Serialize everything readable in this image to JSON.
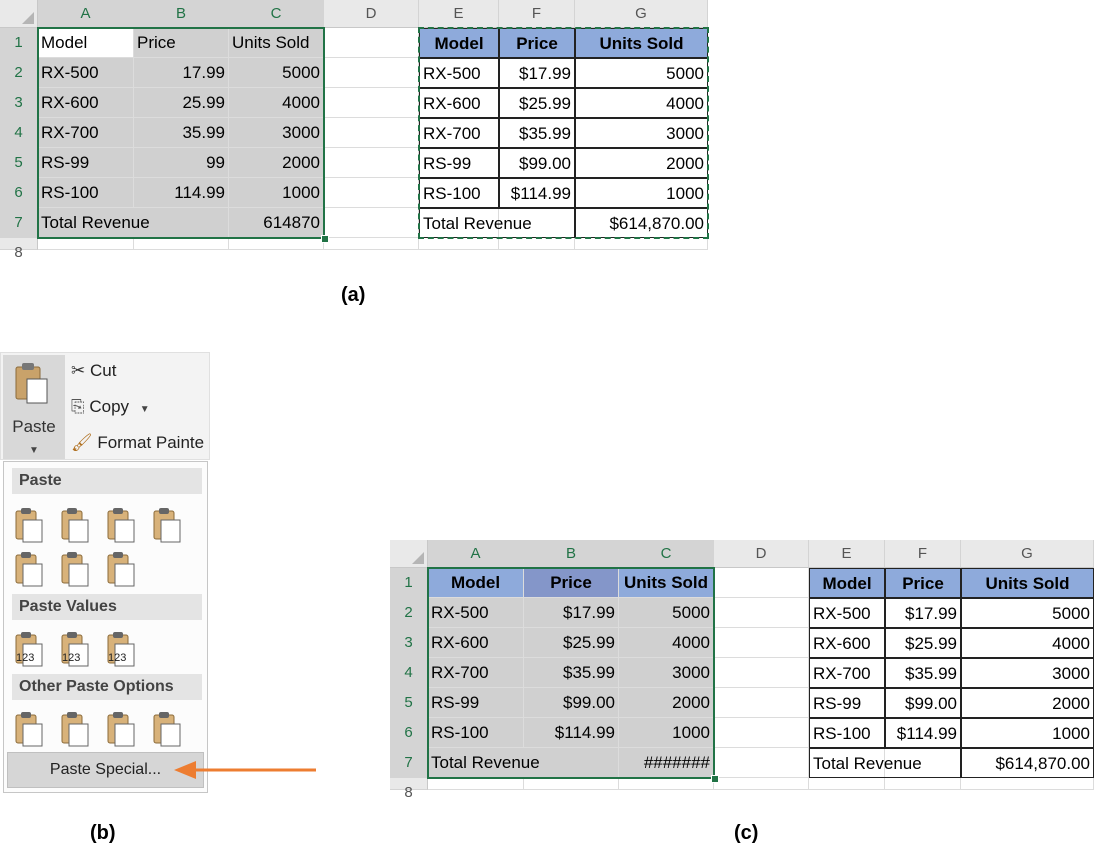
{
  "columns": [
    "A",
    "B",
    "C",
    "D",
    "E",
    "F",
    "G"
  ],
  "rows": [
    "1",
    "2",
    "3",
    "4",
    "5",
    "6",
    "7",
    "8"
  ],
  "left_table": {
    "header": [
      "Model",
      "Price",
      "Units Sold"
    ],
    "data": [
      [
        "RX-500",
        "17.99",
        "5000"
      ],
      [
        "RX-600",
        "25.99",
        "4000"
      ],
      [
        "RX-700",
        "35.99",
        "3000"
      ],
      [
        "RS-99",
        "99",
        "2000"
      ],
      [
        "RS-100",
        "114.99",
        "1000"
      ]
    ],
    "total_label": "Total Revenue",
    "total_value": "614870"
  },
  "right_table": {
    "header": [
      "Model",
      "Price",
      "Units Sold"
    ],
    "data": [
      [
        "RX-500",
        "$17.99",
        "5000"
      ],
      [
        "RX-600",
        "$25.99",
        "4000"
      ],
      [
        "RX-700",
        "$35.99",
        "3000"
      ],
      [
        "RS-99",
        "$99.00",
        "2000"
      ],
      [
        "RS-100",
        "$114.99",
        "1000"
      ]
    ],
    "total_label": "Total Revenue",
    "total_value": "$614,870.00"
  },
  "pasted_table": {
    "header": [
      "Model",
      "Price",
      "Units Sold"
    ],
    "data": [
      [
        "RX-500",
        "$17.99",
        "5000"
      ],
      [
        "RX-600",
        "$25.99",
        "4000"
      ],
      [
        "RX-700",
        "$35.99",
        "3000"
      ],
      [
        "RS-99",
        "$99.00",
        "2000"
      ],
      [
        "RS-100",
        "$114.99",
        "1000"
      ]
    ],
    "total_label": "Total Revenue",
    "total_value": "#######"
  },
  "captions": {
    "a": "(a)",
    "b": "(b)",
    "c": "(c)"
  },
  "ribbon": {
    "paste": "Paste",
    "cut": "Cut",
    "copy": "Copy",
    "format_painter": "Format Painte"
  },
  "paste_menu": {
    "section_paste": "Paste",
    "section_values": "Paste Values",
    "section_other": "Other Paste Options",
    "paste_special": "Paste Special...",
    "values_sub": [
      "123",
      "123",
      "123"
    ]
  },
  "colors": {
    "selection": "#217346",
    "header_blue": "#8eaadb",
    "arrow": "#ed7d31"
  }
}
